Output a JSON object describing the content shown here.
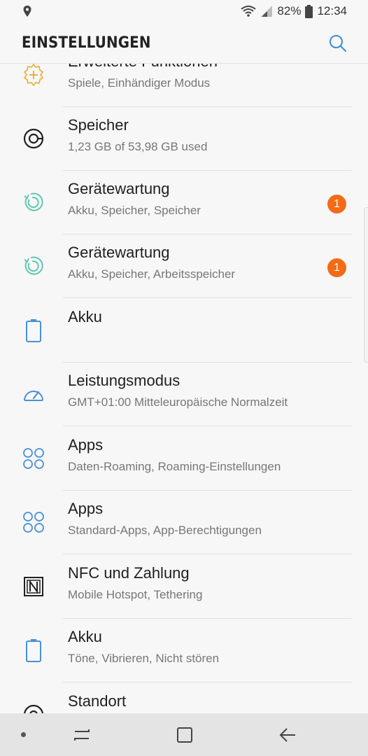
{
  "status": {
    "battery_pct": "82%",
    "time": "12:34",
    "icons": [
      "location-icon",
      "wifi-icon",
      "signal-icon",
      "battery-icon"
    ]
  },
  "appbar": {
    "title": "EINSTELLUNGEN",
    "search_icon": "search-icon"
  },
  "items": [
    {
      "label": "Erweiterte Funktionen",
      "sub": "Spiele, Einhändiger Modus",
      "icon": "gear-plus-icon",
      "icon_color": "#e8b43a"
    },
    {
      "label": "Speicher",
      "sub": "1,23 GB of 53,98 GB used",
      "icon": "storage-icon",
      "icon_color": "#222222"
    },
    {
      "label": "Gerätewartung",
      "sub": "Akku, Speicher, Speicher",
      "icon": "device-care-icon",
      "icon_color": "#5ec7b6",
      "badge": "1"
    },
    {
      "label": "Gerätewartung",
      "sub": "Akku, Speicher, Arbeitsspeicher",
      "icon": "device-care-icon",
      "icon_color": "#5ec7b6",
      "badge": "1"
    },
    {
      "label": "Akku",
      "sub": "",
      "icon": "battery-icon",
      "icon_color": "#4a90d9"
    },
    {
      "label": "Leistungsmodus",
      "sub": "GMT+01:00 Mitteleuropäische Normalzeit",
      "icon": "gauge-icon",
      "icon_color": "#4a90d9"
    },
    {
      "label": "Apps",
      "sub": "Daten-Roaming, Roaming-Einstellungen",
      "icon": "apps-icon",
      "icon_color": "#4a90d9"
    },
    {
      "label": "Apps",
      "sub": "Standard-Apps, App-Berechtigungen",
      "icon": "apps-icon",
      "icon_color": "#4a90d9"
    },
    {
      "label": "NFC und Zahlung",
      "sub": "Mobile Hotspot, Tethering",
      "icon": "nfc-icon",
      "icon_color": "#222222"
    },
    {
      "label": "Akku",
      "sub": "Töne, Vibrieren, Nicht stören",
      "icon": "battery-icon",
      "icon_color": "#4a90d9"
    },
    {
      "label": "Standort",
      "sub": "",
      "icon": "location-target-icon",
      "icon_color": "#222222"
    }
  ],
  "colors": {
    "badge": "#f26b16",
    "accent": "#4a90d9"
  }
}
